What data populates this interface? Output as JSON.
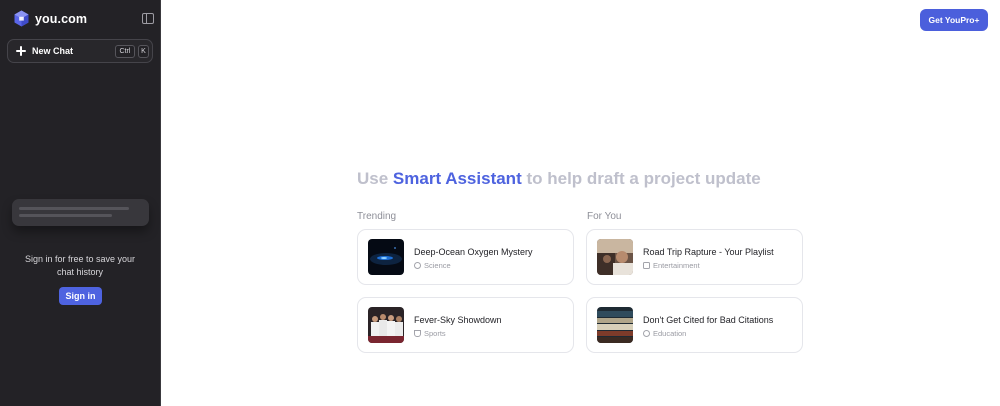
{
  "sidebar": {
    "brand": "you.com",
    "new_chat_label": "New Chat",
    "shortcut": [
      "Ctrl",
      "K"
    ],
    "signin_message": "Sign in for free to save your chat history",
    "signin_button": "Sign in"
  },
  "header": {
    "get_pro_label": "Get YouPro+"
  },
  "hero": {
    "prefix": "Use ",
    "assistant": "Smart Assistant",
    "suffix": " to help draft a project update"
  },
  "sections": {
    "trending": "Trending",
    "for_you": "For You"
  },
  "cards": [
    {
      "title": "Deep-Ocean Oxygen Mystery",
      "category": "Science"
    },
    {
      "title": "Road Trip Rapture - Your Playlist",
      "category": "Entertainment"
    },
    {
      "title": "Fever-Sky Showdown",
      "category": "Sports"
    },
    {
      "title": "Don't Get Cited for Bad Citations",
      "category": "Education"
    }
  ],
  "colors": {
    "sidebar_bg": "#232226",
    "accent": "#4e63df",
    "button": "#4b5fdc"
  }
}
